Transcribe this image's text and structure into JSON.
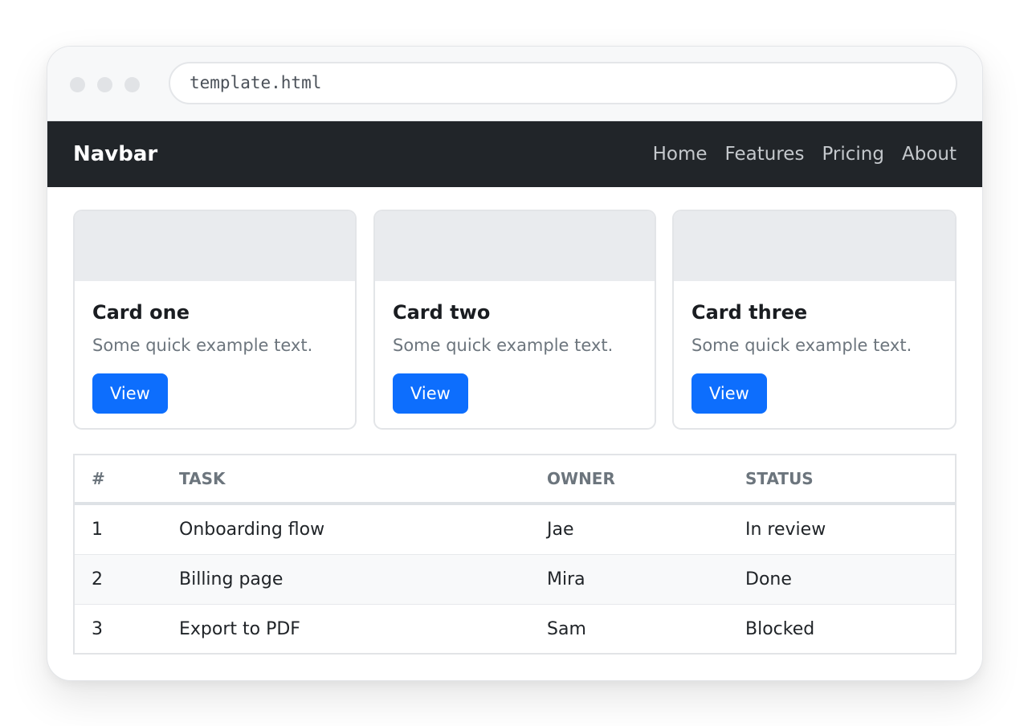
{
  "browser": {
    "url": "template.html"
  },
  "navbar": {
    "brand": "Navbar",
    "links": [
      "Home",
      "Features",
      "Pricing",
      "About"
    ]
  },
  "cards": [
    {
      "title": "Card one",
      "text": "Some quick example text.",
      "button": "View"
    },
    {
      "title": "Card two",
      "text": "Some quick example text.",
      "button": "View"
    },
    {
      "title": "Card three",
      "text": "Some quick example text.",
      "button": "View"
    }
  ],
  "table": {
    "headers": [
      "#",
      "TASK",
      "OWNER",
      "STATUS"
    ],
    "rows": [
      [
        "1",
        "Onboarding flow",
        "Jae",
        "In review"
      ],
      [
        "2",
        "Billing page",
        "Mira",
        "Done"
      ],
      [
        "3",
        "Export to PDF",
        "Sam",
        "Blocked"
      ]
    ]
  },
  "colors": {
    "navbar_bg": "#212529",
    "primary": "#0d6efd",
    "muted_text": "#6c757d"
  }
}
